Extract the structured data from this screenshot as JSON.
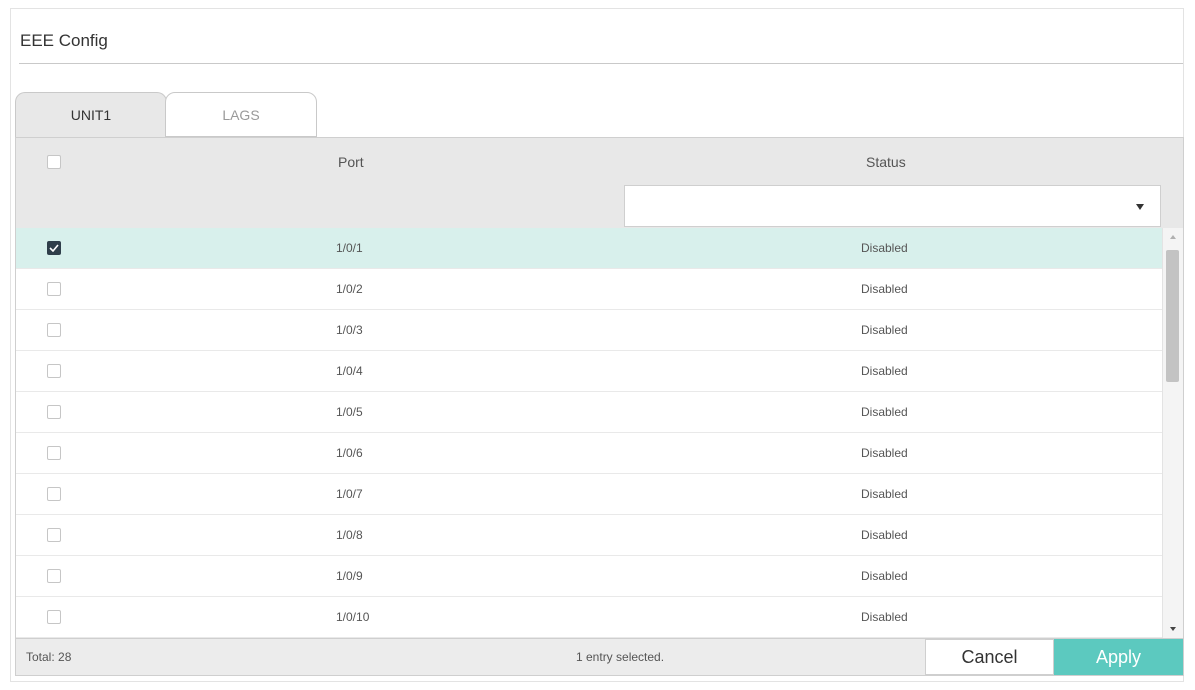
{
  "panel": {
    "title": "EEE Config"
  },
  "tabs": [
    {
      "label": "UNIT1",
      "active": true
    },
    {
      "label": "LAGS",
      "active": false
    }
  ],
  "table": {
    "columns": {
      "port": "Port",
      "status": "Status"
    },
    "filter": {
      "status_value": ""
    },
    "rows": [
      {
        "port": "1/0/1",
        "status": "Disabled",
        "checked": true
      },
      {
        "port": "1/0/2",
        "status": "Disabled",
        "checked": false
      },
      {
        "port": "1/0/3",
        "status": "Disabled",
        "checked": false
      },
      {
        "port": "1/0/4",
        "status": "Disabled",
        "checked": false
      },
      {
        "port": "1/0/5",
        "status": "Disabled",
        "checked": false
      },
      {
        "port": "1/0/6",
        "status": "Disabled",
        "checked": false
      },
      {
        "port": "1/0/7",
        "status": "Disabled",
        "checked": false
      },
      {
        "port": "1/0/8",
        "status": "Disabled",
        "checked": false
      },
      {
        "port": "1/0/9",
        "status": "Disabled",
        "checked": false
      },
      {
        "port": "1/0/10",
        "status": "Disabled",
        "checked": false
      }
    ]
  },
  "footer": {
    "total": "Total: 28",
    "selected_info": "1 entry selected.",
    "cancel_label": "Cancel",
    "apply_label": "Apply"
  },
  "colors": {
    "accent": "#5cc9bf",
    "selected_row": "#d8f0ec",
    "header_bg": "#e8e8e8"
  },
  "icons": {
    "checkmark": "checkmark-icon",
    "dropdown": "chevron-down-icon",
    "scroll_up": "scroll-up-arrow-icon",
    "scroll_down": "scroll-down-arrow-icon"
  }
}
